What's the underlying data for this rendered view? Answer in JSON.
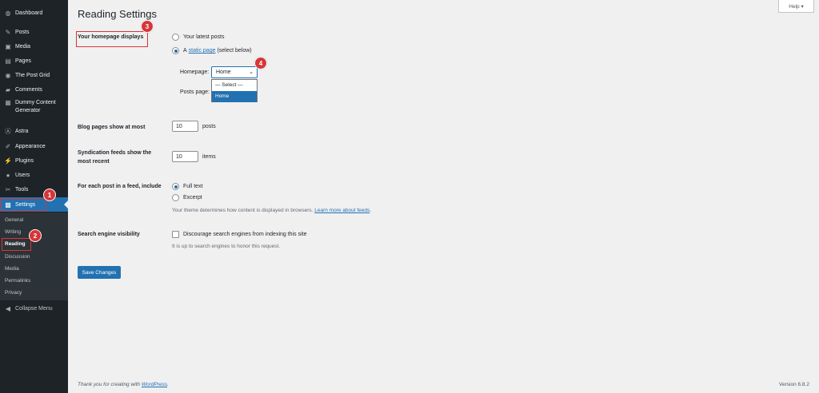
{
  "sidebar": {
    "items": [
      {
        "label": "Dashboard",
        "icon": "dashboard-icon",
        "glyph": "◍"
      },
      {
        "label": "Posts",
        "icon": "pin-icon",
        "glyph": "✎"
      },
      {
        "label": "Media",
        "icon": "media-icon",
        "glyph": "▣"
      },
      {
        "label": "Pages",
        "icon": "pages-icon",
        "glyph": "▤"
      },
      {
        "label": "The Post Grid",
        "icon": "post-grid-icon",
        "glyph": "◉"
      },
      {
        "label": "Comments",
        "icon": "comment-icon",
        "glyph": "▰"
      },
      {
        "label": "Dummy Content Generator",
        "icon": "generator-icon",
        "glyph": "▦"
      },
      {
        "label": "Astra",
        "icon": "astra-icon",
        "glyph": "Ⓐ"
      },
      {
        "label": "Appearance",
        "icon": "paintbrush-icon",
        "glyph": "✐"
      },
      {
        "label": "Plugins",
        "icon": "plugin-icon",
        "glyph": "⚡"
      },
      {
        "label": "Users",
        "icon": "users-icon",
        "glyph": "●"
      },
      {
        "label": "Tools",
        "icon": "wrench-icon",
        "glyph": "✂"
      },
      {
        "label": "Settings",
        "icon": "settings-icon",
        "glyph": "▩"
      }
    ],
    "submenu": [
      "General",
      "Writing",
      "Reading",
      "Discussion",
      "Media",
      "Permalinks",
      "Privacy"
    ],
    "collapse": {
      "label": "Collapse Menu",
      "glyph": "◀"
    }
  },
  "help": "Help ▾",
  "page_title": "Reading Settings",
  "homepage": {
    "label": "Your homepage displays",
    "opt_latest": "Your latest posts",
    "opt_static_prefix": "A",
    "opt_static_link": "static page",
    "opt_static_suffix": "(select below)",
    "homepage_label": "Homepage:",
    "homepage_value": "Home",
    "posts_page_label": "Posts page:",
    "dropdown_options": [
      "— Select —",
      "Home"
    ]
  },
  "blog_pages": {
    "label": "Blog pages show at most",
    "value": "10",
    "unit": "posts"
  },
  "syndication": {
    "label_line1": "Syndication feeds show the",
    "label_line2": "most recent",
    "value": "10",
    "unit": "items"
  },
  "feed_include": {
    "label": "For each post in a feed, include",
    "opt_full": "Full text",
    "opt_excerpt": "Excerpt",
    "desc_prefix": "Your theme determines how content is displayed in browsers.",
    "desc_link": "Learn more about feeds"
  },
  "search_visibility": {
    "label": "Search engine visibility",
    "checkbox_label": "Discourage search engines from indexing this site",
    "desc": "It is up to search engines to honor this request."
  },
  "save_label": "Save Changes",
  "footer": {
    "prefix": "Thank you for creating with",
    "link": "WordPress",
    "version": "Version 6.8.2"
  },
  "markers": [
    "1",
    "2",
    "3",
    "4"
  ],
  "colors": {
    "sidebar": "#1d2327",
    "accent": "#2271b1",
    "annotation": "#d63638"
  }
}
